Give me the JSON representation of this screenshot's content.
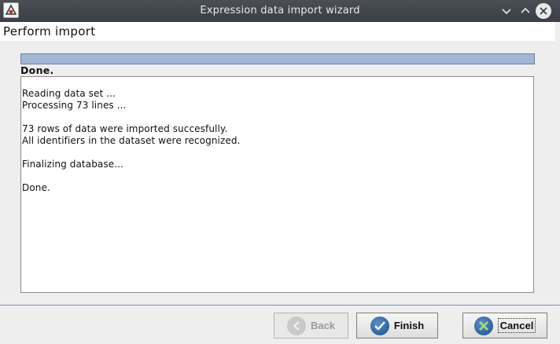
{
  "window": {
    "title": "Expression data import wizard",
    "app_icon": "application-icon",
    "controls": [
      "minimize-icon",
      "maximize-icon",
      "close-icon"
    ]
  },
  "header": {
    "title": "Perform import"
  },
  "progress": {
    "percent": 100
  },
  "status": {
    "text": "Done."
  },
  "log": {
    "lines": [
      "Reading data set ...",
      "Processing 73 lines ...",
      "",
      "73 rows of data were imported succesfully.",
      "All identifiers in the dataset were recognized.",
      "",
      "Finalizing database...",
      "",
      "Done."
    ]
  },
  "buttons": {
    "back": {
      "label": "Back",
      "enabled": false,
      "icon": "back-arrow-icon"
    },
    "finish": {
      "label": "Finish",
      "enabled": true,
      "icon": "checkmark-icon"
    },
    "cancel": {
      "label": "Cancel",
      "enabled": true,
      "icon": "cancel-x-icon"
    }
  },
  "colors": {
    "titlebar": "#3e4247",
    "progress_fill": "#a3b6d4",
    "separator": "#7d8fb1",
    "button_icon": "#1d4f8a"
  }
}
